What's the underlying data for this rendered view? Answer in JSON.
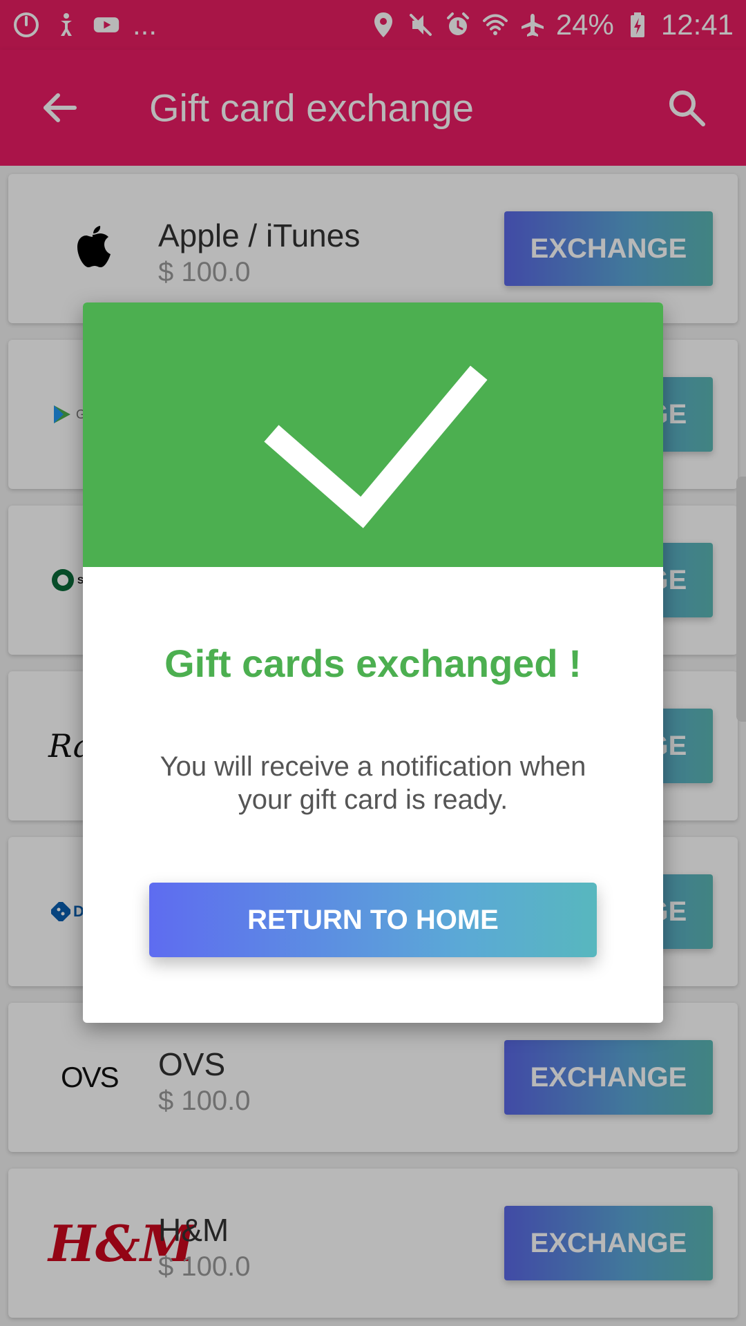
{
  "status_bar": {
    "battery_percent": "24%",
    "time": "12:41",
    "overflow": "..."
  },
  "app_bar": {
    "title": "Gift card exchange"
  },
  "cards": [
    {
      "name": "Apple / iTunes",
      "value": "$ 100.0",
      "button": "EXCHANGE"
    },
    {
      "name": "",
      "value": "",
      "button": "EXCHANGE"
    },
    {
      "name": "",
      "value": "",
      "button": "EXCHANGE"
    },
    {
      "name": "",
      "value": "",
      "button": "EXCHANGE"
    },
    {
      "name": "",
      "value": "",
      "button": "EXCHANGE"
    },
    {
      "name": "OVS",
      "value": "$ 100.0",
      "button": "EXCHANGE"
    },
    {
      "name": "H&M",
      "value": "$ 100.0",
      "button": "EXCHANGE"
    }
  ],
  "logos": {
    "google_play_text": "Goo",
    "starbucks_text": "STA",
    "rayban_text": "Ray",
    "dominos_text": "Dor",
    "ovs_text": "OVS",
    "hm_text": "H&M"
  },
  "dialog": {
    "title": "Gift cards exchanged !",
    "message": "You will receive a notification when your gift card is ready.",
    "button": "RETURN TO HOME"
  },
  "colors": {
    "primary": "#E91E63",
    "success": "#4CAF50",
    "button_gradient_start": "#5A68E6",
    "button_gradient_end": "#5AB7B4"
  },
  "icons": {
    "status_left": [
      "app-icon",
      "accessibility-icon",
      "youtube-icon"
    ],
    "status_right": [
      "location-icon",
      "mute-icon",
      "alarm-icon",
      "wifi-icon",
      "airplane-icon",
      "battery-icon"
    ],
    "app_bar": [
      "back-arrow-icon",
      "search-icon"
    ]
  }
}
